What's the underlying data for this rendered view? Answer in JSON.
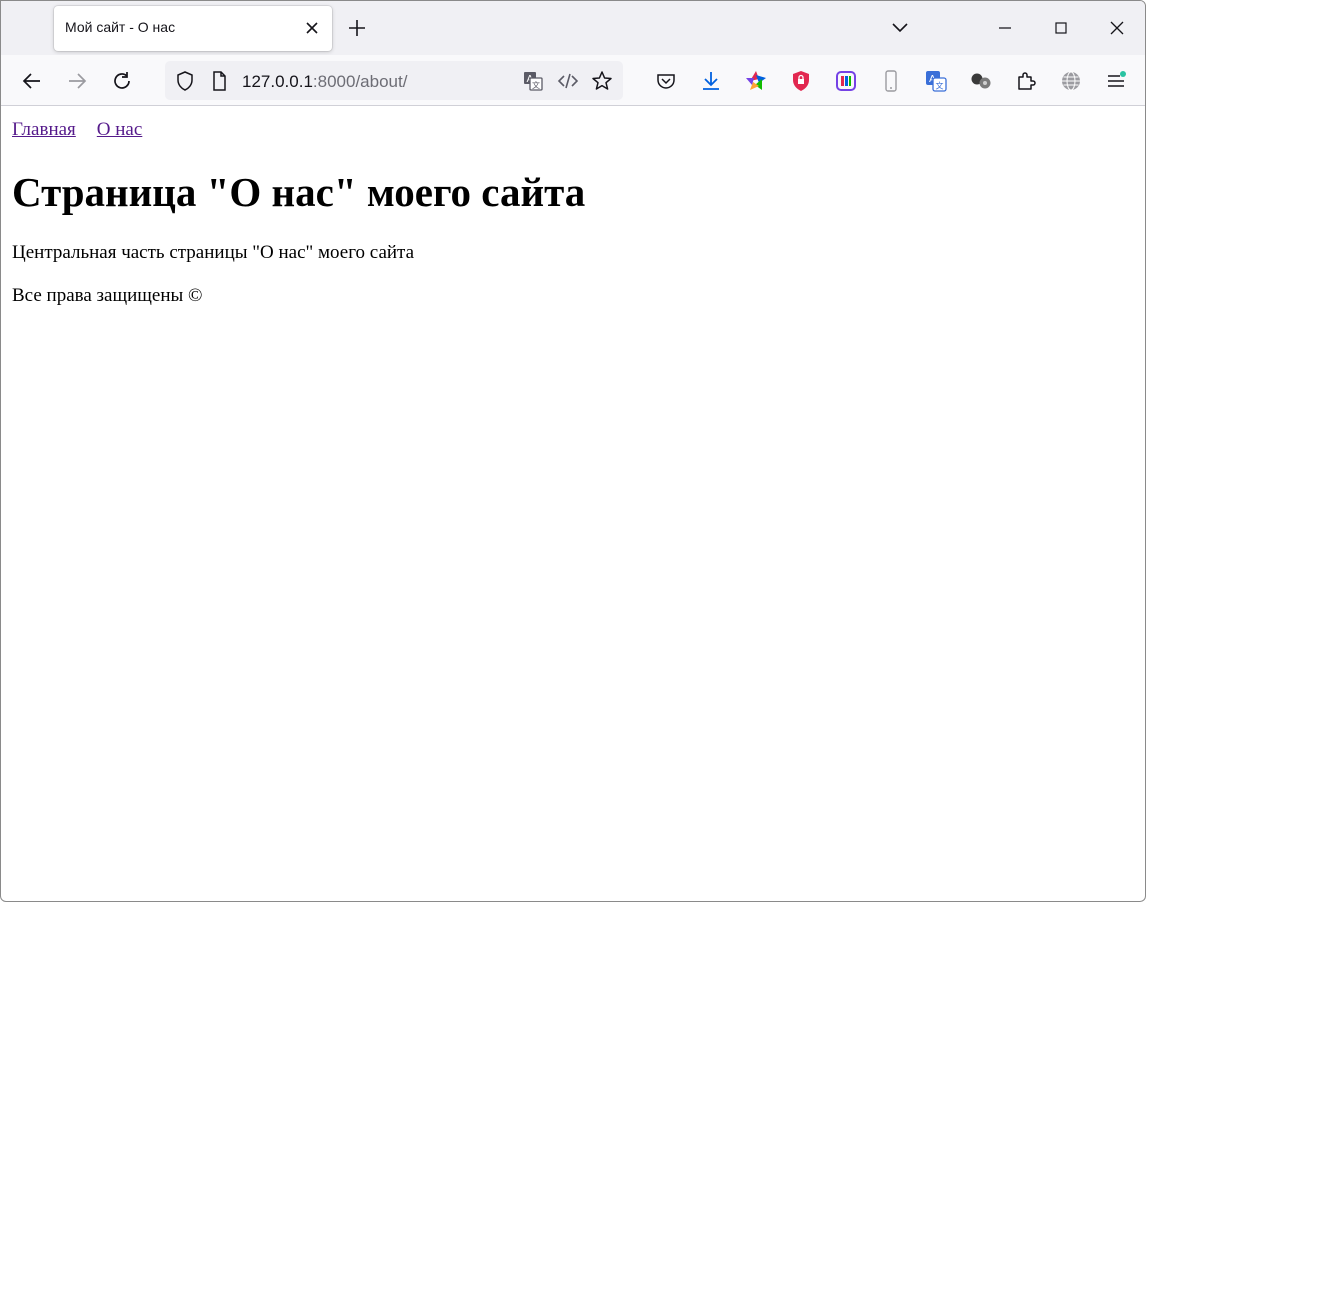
{
  "browser": {
    "tab": {
      "title": "Мой сайт - О нас"
    },
    "url": {
      "host": "127.0.0.1",
      "rest": ":8000/about/"
    }
  },
  "page": {
    "nav": [
      "Главная",
      "О нас"
    ],
    "heading": "Страница \"О нас\" моего сайта",
    "body_text": "Центральная часть страницы \"О нас\" моего сайта",
    "footer_text": "Все права защищены ©"
  },
  "colors": {
    "visited_link": "#551a8b",
    "tabstrip_bg": "#f0f0f4",
    "toolbar_bg": "#f9f9fb",
    "download_blue": "#0060df",
    "shield_red": "#e22850",
    "addon_purple": "#7542e5",
    "translate_blue": "#3a6fd8",
    "notify_green": "#2ac3a2"
  },
  "icons": [
    "back-arrow-icon",
    "forward-arrow-icon",
    "reload-icon",
    "shield-icon",
    "page-icon",
    "translate-icon",
    "code-icon",
    "bookmark-star-icon",
    "pocket-icon",
    "download-icon",
    "colorful-star-icon",
    "red-shield-icon",
    "purple-addon-icon",
    "phone-icon",
    "translate-addon-icon",
    "circles-icon",
    "puzzle-icon",
    "globe-icon",
    "menu-icon"
  ]
}
